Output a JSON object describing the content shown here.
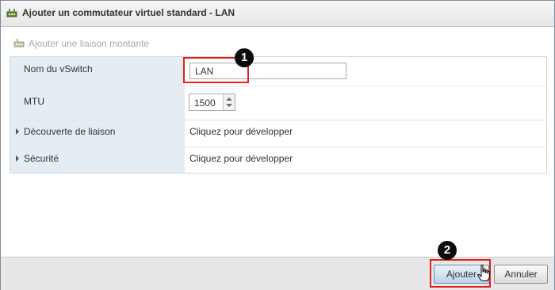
{
  "dialog": {
    "title": "Ajouter un commutateur virtuel standard - LAN",
    "add_uplink_label": "Ajouter une liaison montante"
  },
  "form": {
    "name_label": "Nom du vSwitch",
    "name_value": "LAN",
    "mtu_label": "MTU",
    "mtu_value": "1500",
    "discovery_label": "Découverte de liaison",
    "discovery_value": "Cliquez pour développer",
    "security_label": "Sécurité",
    "security_value": "Cliquez pour développer"
  },
  "footer": {
    "add_label": "Ajouter",
    "cancel_label": "Annuler"
  },
  "callouts": {
    "step1": "1",
    "step2": "2"
  },
  "colors": {
    "highlight": "#e0231f",
    "label_bg": "#e4edf4"
  }
}
